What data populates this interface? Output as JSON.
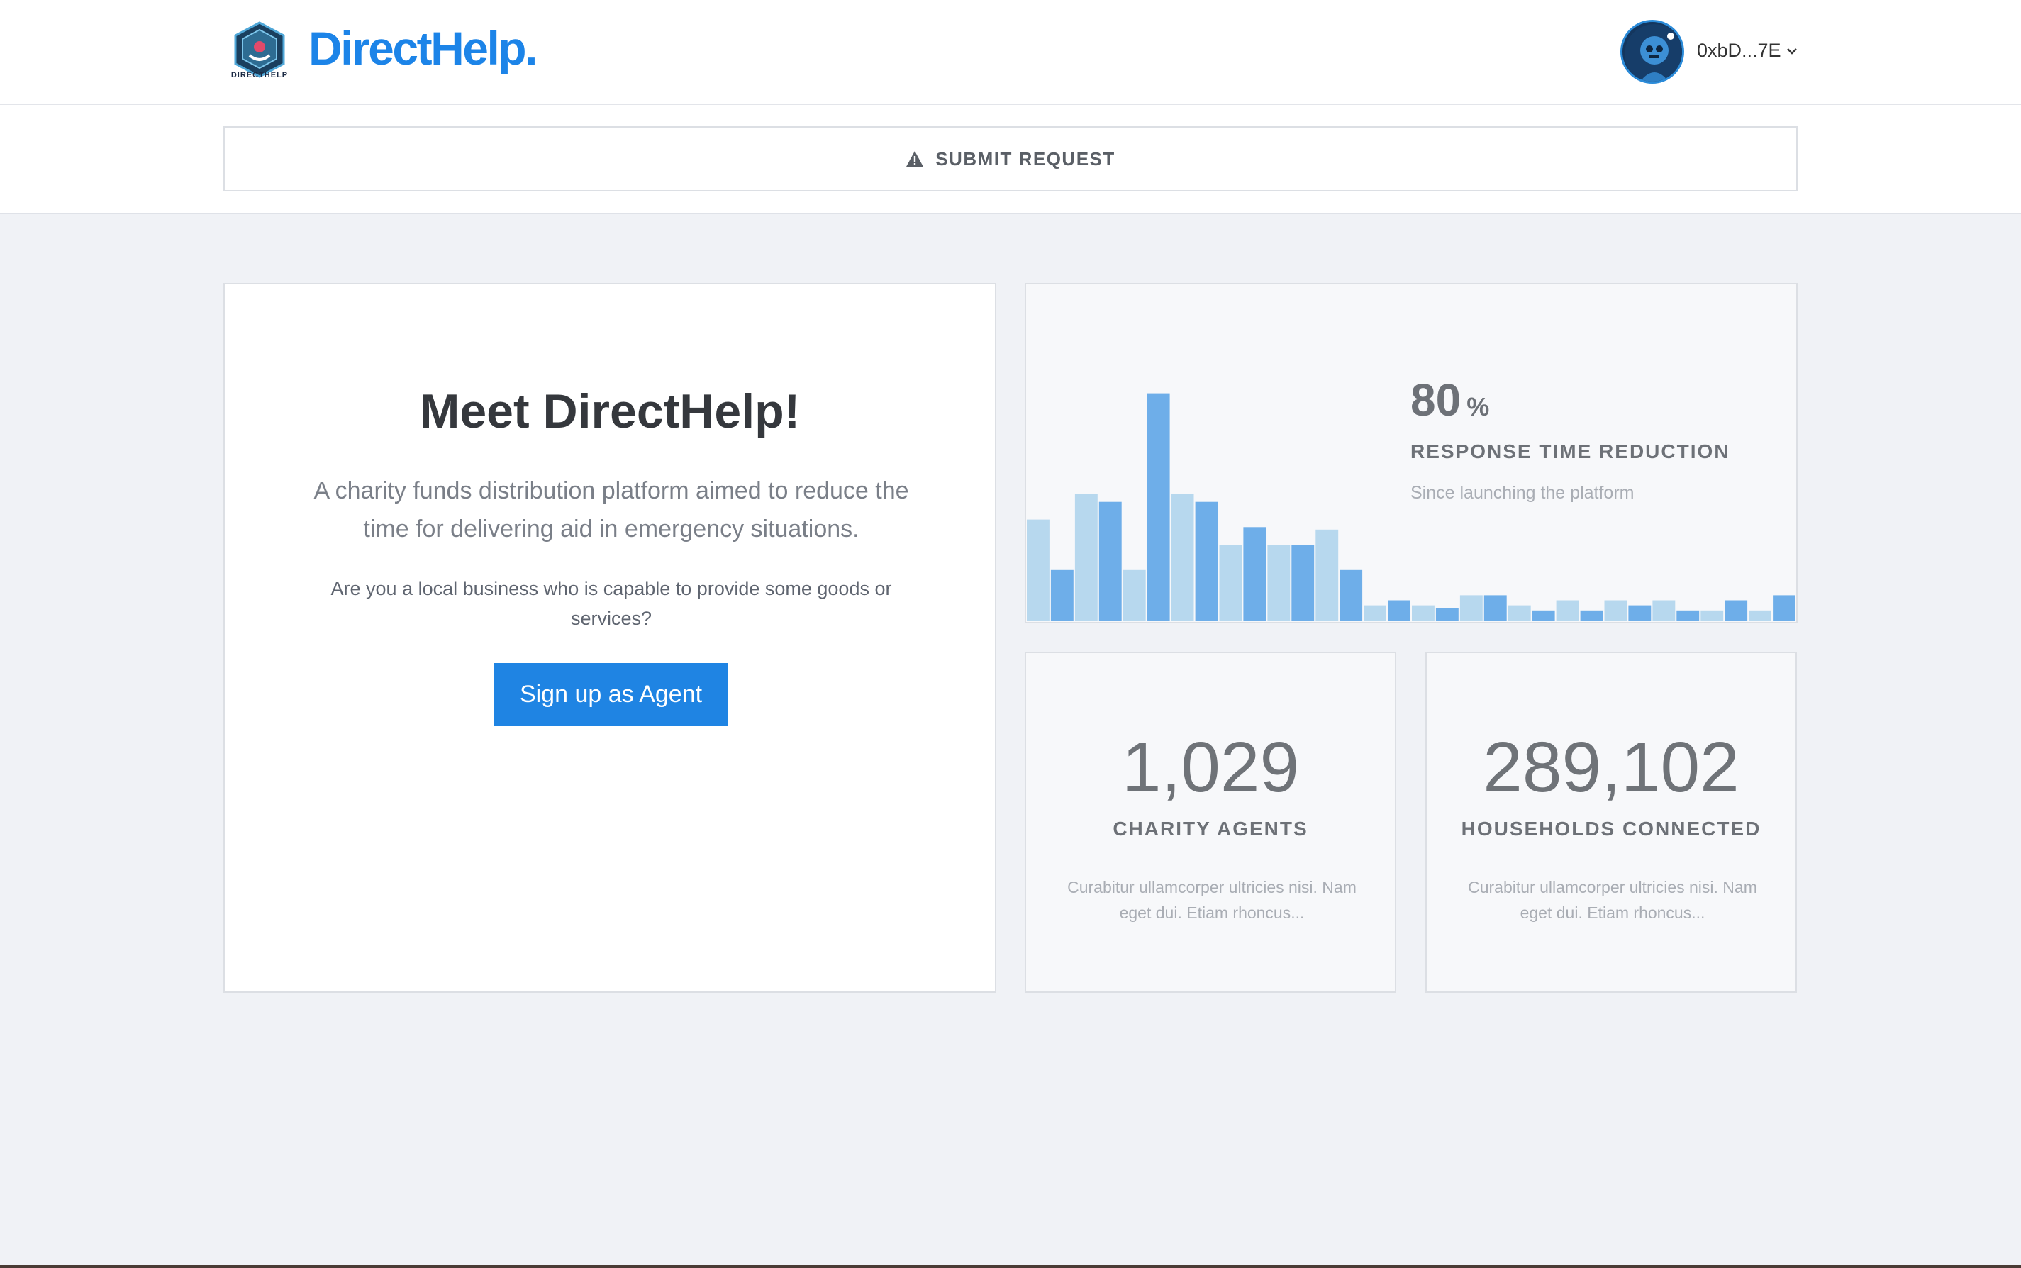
{
  "header": {
    "logo_small_text": "DIRECTHELP",
    "brand_name": "DirectHelp.",
    "account_address": "0xbD...7E",
    "logo_icon": "directhelp-logo-icon",
    "avatar_icon": "robot-avatar-icon",
    "chevron_icon": "chevron-down-icon"
  },
  "request_bar": {
    "icon": "warning-icon",
    "label": "SUBMIT REQUEST"
  },
  "intro": {
    "title": "Meet DirectHelp!",
    "description": "A charity funds distribution platform aimed to reduce the time for delivering aid in emergency situations.",
    "question": "Are you a local business who is capable to provide some goods or services?",
    "signup_label": "Sign up as Agent"
  },
  "response_stat": {
    "value": "80",
    "unit": "%",
    "label": "RESPONSE TIME REDUCTION",
    "sublabel": "Since launching the platform"
  },
  "chart_data": {
    "type": "bar",
    "series": [
      {
        "values": [
          40,
          50,
          20,
          50,
          30,
          30,
          36,
          6,
          6,
          10,
          6,
          8,
          8,
          8,
          4,
          4
        ]
      },
      {
        "values": [
          20,
          47,
          90,
          47,
          37,
          30,
          20,
          8,
          5,
          10,
          4,
          4,
          6,
          4,
          8,
          10
        ]
      }
    ],
    "colors": [
      "#b7d8ee",
      "#6eaee9"
    ]
  },
  "stats": [
    {
      "value": "1,029",
      "label": "CHARITY AGENTS",
      "description": "Curabitur ullamcorper ultricies nisi. Nam eget dui. Etiam rhoncus..."
    },
    {
      "value": "289,102",
      "label": "HOUSEHOLDS CONNECTED",
      "description": "Curabitur ullamcorper ultricies nisi. Nam eget dui. Etiam rhoncus..."
    }
  ],
  "colors": {
    "brand": "#1c84e8",
    "button": "#1f84e3",
    "page_bg": "#f0f2f6"
  }
}
